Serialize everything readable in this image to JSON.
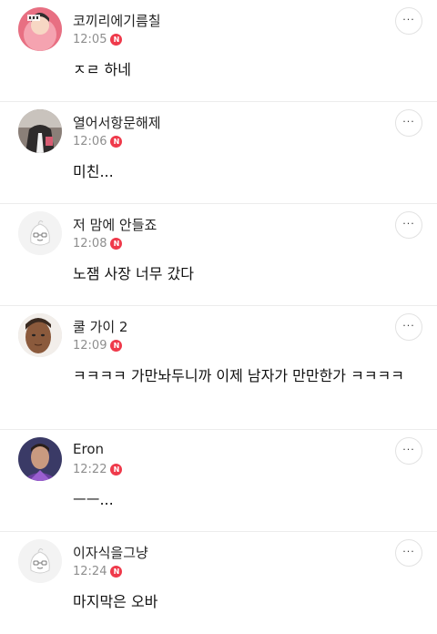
{
  "comments": [
    {
      "author": "코끼리에기름칠",
      "time": "12:05",
      "badge": "N",
      "text": "ㅈㄹ 하네",
      "avatar_icon": "cartoon-avatar-icon",
      "more_label": "···"
    },
    {
      "author": "열어서항문해제",
      "time": "12:06",
      "badge": "N",
      "text": "미친...",
      "avatar_icon": "photo-avatar-icon",
      "more_label": "···"
    },
    {
      "author": "저 맘에 안들죠",
      "time": "12:08",
      "badge": "N",
      "text": "노잼 사장 너무 갔다",
      "avatar_icon": "default-avatar-icon",
      "more_label": "···"
    },
    {
      "author": "쿨 가이 2",
      "time": "12:09",
      "badge": "N",
      "text": "ㅋㅋㅋㅋ 가만놔두니까 이제 남자가 만만한가 ㅋㅋㅋㅋ",
      "avatar_icon": "photo-avatar-icon",
      "more_label": "···"
    },
    {
      "author": "Eron",
      "time": "12:22",
      "badge": "N",
      "text": "ㅡㅡ...",
      "avatar_icon": "photo-avatar-icon",
      "more_label": "···"
    },
    {
      "author": "이자식을그냥",
      "time": "12:24",
      "badge": "N",
      "text": "마지막은 오바",
      "avatar_icon": "default-avatar-icon",
      "more_label": "···"
    }
  ],
  "colors": {
    "new_badge": "#ef3a4b",
    "meta_text": "#8e8e8e",
    "divider": "#ececec"
  }
}
